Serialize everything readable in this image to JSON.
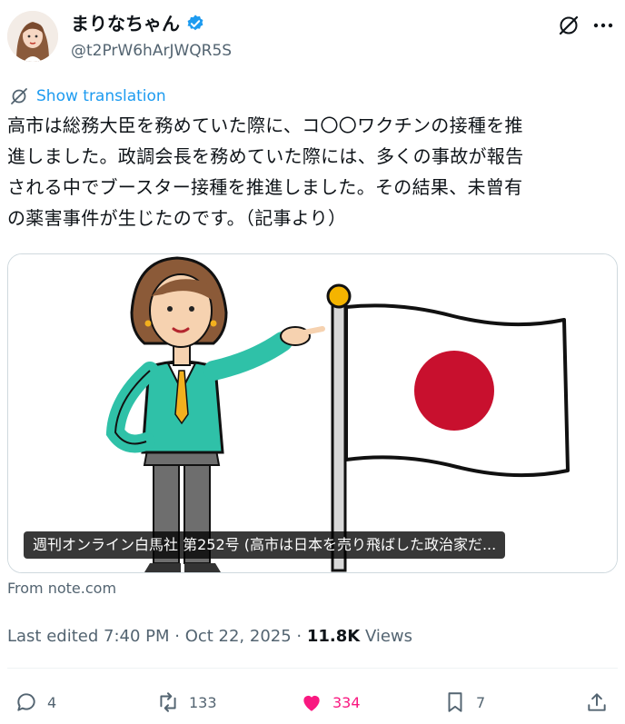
{
  "author": {
    "display_name": "まりなちゃん",
    "handle": "@t2PrW6hArJWQR5S",
    "verified_icon": "verified-badge-icon"
  },
  "header_actions": {
    "grok_icon": "grok-icon",
    "more_icon": "more-horizontal-icon"
  },
  "translation": {
    "label": "Show translation",
    "icon": "translate-icon"
  },
  "tweet": {
    "text": "高市は総務大臣を務めていた際に、コ〇〇ワクチンの接種を推\n進しました。政調会長を務めていた際には、多くの事故が報告\nされる中でブースター接種を推進しました。その結果、未曾有\nの薬害事件が生じたのです。（記事より）"
  },
  "card": {
    "title": "週刊オンライン白馬社 第252号 (高市は日本を売り飛ばした政治家だ...",
    "source": "From note.com",
    "image_icon": "woman-pointing-at-japan-flag-illustration"
  },
  "meta": {
    "edited": "Last edited 7:40 PM · Oct 22, 2025 · ",
    "views_count": "11.8K",
    "views_label": " Views"
  },
  "actions": {
    "reply_count": "4",
    "repost_count": "133",
    "like_count": "334",
    "bookmark_count": "7",
    "like_color": "#f91880"
  },
  "colors": {
    "accent": "#1d9bf0",
    "secondary_text": "#536471",
    "flag_red": "#c8102e"
  }
}
